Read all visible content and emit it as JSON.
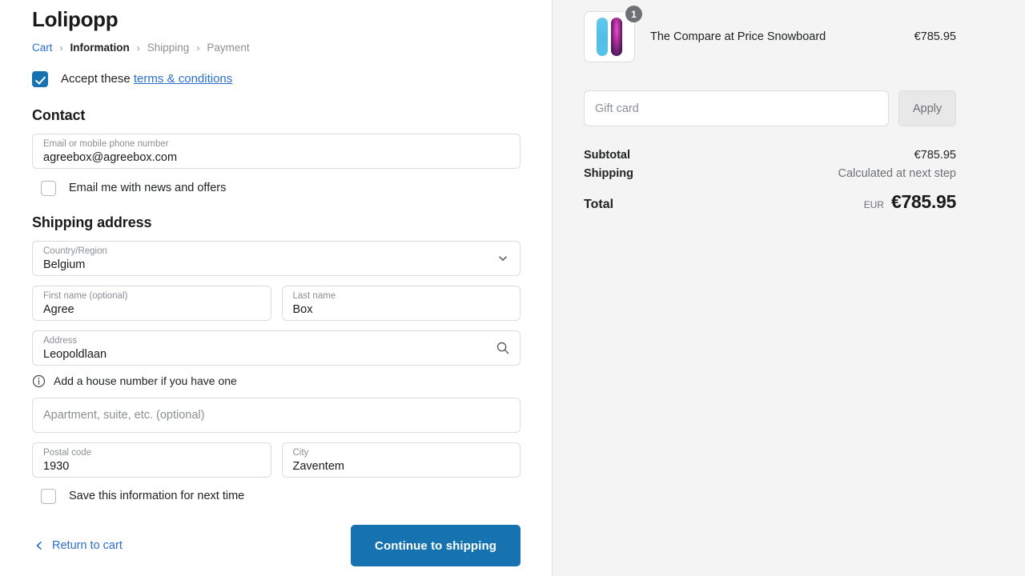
{
  "shop": {
    "name": "Lolipopp"
  },
  "breadcrumb": {
    "items": [
      {
        "label": "Cart",
        "state": "link"
      },
      {
        "label": "Information",
        "state": "current"
      },
      {
        "label": "Shipping",
        "state": "muted"
      },
      {
        "label": "Payment",
        "state": "muted"
      }
    ],
    "separator": "›"
  },
  "terms": {
    "checked": true,
    "prefix": "Accept these",
    "link_label": "terms & conditions"
  },
  "contact": {
    "heading": "Contact",
    "email_field": {
      "label": "Email or mobile phone number",
      "value": "agreebox@agreebox.com"
    },
    "newsletter": {
      "label": "Email me with news and offers",
      "checked": false
    }
  },
  "shipping_address": {
    "heading": "Shipping address",
    "country": {
      "label": "Country/Region",
      "value": "Belgium"
    },
    "first_name": {
      "label": "First name (optional)",
      "value": "Agree"
    },
    "last_name": {
      "label": "Last name",
      "value": "Box"
    },
    "address": {
      "label": "Address",
      "value": "Leopoldlaan"
    },
    "address_hint": "Add a house number if you have one",
    "apartment": {
      "placeholder": "Apartment, suite, etc. (optional)",
      "value": ""
    },
    "postal_code": {
      "label": "Postal code",
      "value": "1930"
    },
    "city": {
      "label": "City",
      "value": "Zaventem"
    },
    "save_info": {
      "label": "Save this information for next time",
      "checked": false
    }
  },
  "actions": {
    "return_label": "Return to cart",
    "continue_label": "Continue to shipping"
  },
  "summary": {
    "line_item": {
      "name": "The Compare at Price Snowboard",
      "price": "€785.95",
      "quantity": "1"
    },
    "gift_card": {
      "placeholder": "Gift card",
      "value": "",
      "apply_label": "Apply"
    },
    "subtotal": {
      "label": "Subtotal",
      "value": "€785.95"
    },
    "shipping": {
      "label": "Shipping",
      "value": "Calculated at next step"
    },
    "total": {
      "label": "Total",
      "currency": "EUR",
      "value": "€785.95"
    }
  },
  "colors": {
    "accent_blue": "#1773b0",
    "link_blue": "#2c6ecb",
    "panel_bg": "#f4f4f4",
    "text": "#202223",
    "muted": "#8c9196"
  }
}
